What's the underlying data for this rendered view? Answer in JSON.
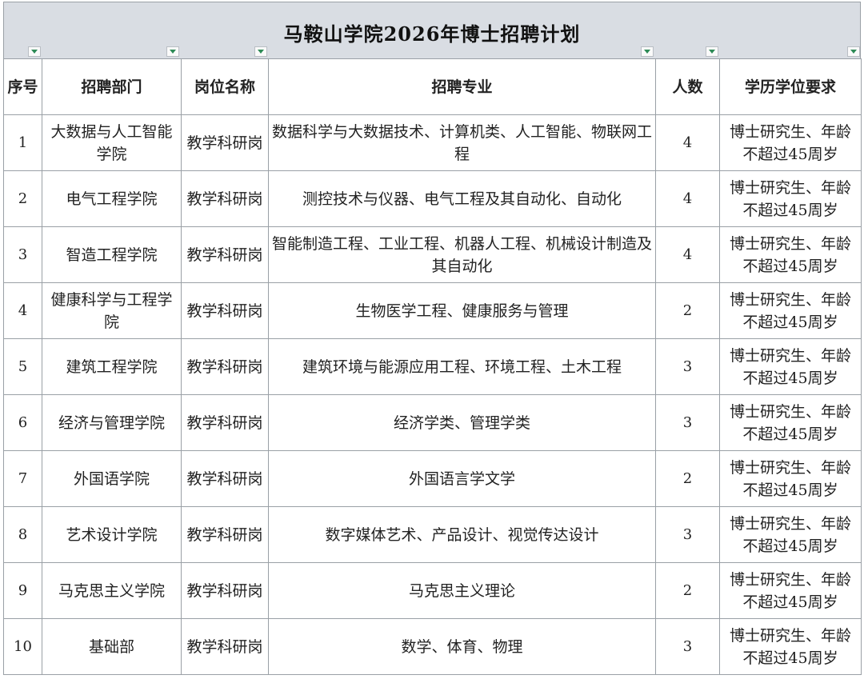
{
  "title": "马鞍山学院2026年博士招聘计划",
  "headers": [
    "序号",
    "招聘部门",
    "岗位名称",
    "招聘专业",
    "人数",
    "学历学位要求"
  ],
  "rows": [
    {
      "no": "1",
      "dept": "大数据与人工智能学院",
      "post": "教学科研岗",
      "major": "数据科学与大数据技术、计算机类、人工智能、物联网工程",
      "count": "4",
      "req": "博士研究生、年龄不超过45周岁"
    },
    {
      "no": "2",
      "dept": "电气工程学院",
      "post": "教学科研岗",
      "major": "测控技术与仪器、电气工程及其自动化、自动化",
      "count": "4",
      "req": "博士研究生、年龄不超过45周岁"
    },
    {
      "no": "3",
      "dept": "智造工程学院",
      "post": "教学科研岗",
      "major": "智能制造工程、工业工程、机器人工程、机械设计制造及其自动化",
      "count": "4",
      "req": "博士研究生、年龄不超过45周岁"
    },
    {
      "no": "4",
      "dept": "健康科学与工程学院",
      "post": "教学科研岗",
      "major": "生物医学工程、健康服务与管理",
      "count": "2",
      "req": "博士研究生、年龄不超过45周岁"
    },
    {
      "no": "5",
      "dept": "建筑工程学院",
      "post": "教学科研岗",
      "major": "建筑环境与能源应用工程、环境工程、土木工程",
      "count": "3",
      "req": "博士研究生、年龄不超过45周岁"
    },
    {
      "no": "6",
      "dept": "经济与管理学院",
      "post": "教学科研岗",
      "major": "经济学类、管理学类",
      "count": "3",
      "req": "博士研究生、年龄不超过45周岁"
    },
    {
      "no": "7",
      "dept": "外国语学院",
      "post": "教学科研岗",
      "major": "外国语言学文学",
      "count": "2",
      "req": "博士研究生、年龄不超过45周岁"
    },
    {
      "no": "8",
      "dept": "艺术设计学院",
      "post": "教学科研岗",
      "major": "数字媒体艺术、产品设计、视觉传达设计",
      "count": "3",
      "req": "博士研究生、年龄不超过45周岁"
    },
    {
      "no": "9",
      "dept": "马克思主义学院",
      "post": "教学科研岗",
      "major": "马克思主义理论",
      "count": "2",
      "req": "博士研究生、年龄不超过45周岁"
    },
    {
      "no": "10",
      "dept": "基础部",
      "post": "教学科研岗",
      "major": "数学、体育、物理",
      "count": "3",
      "req": "博士研究生、年龄不超过45周岁"
    }
  ]
}
